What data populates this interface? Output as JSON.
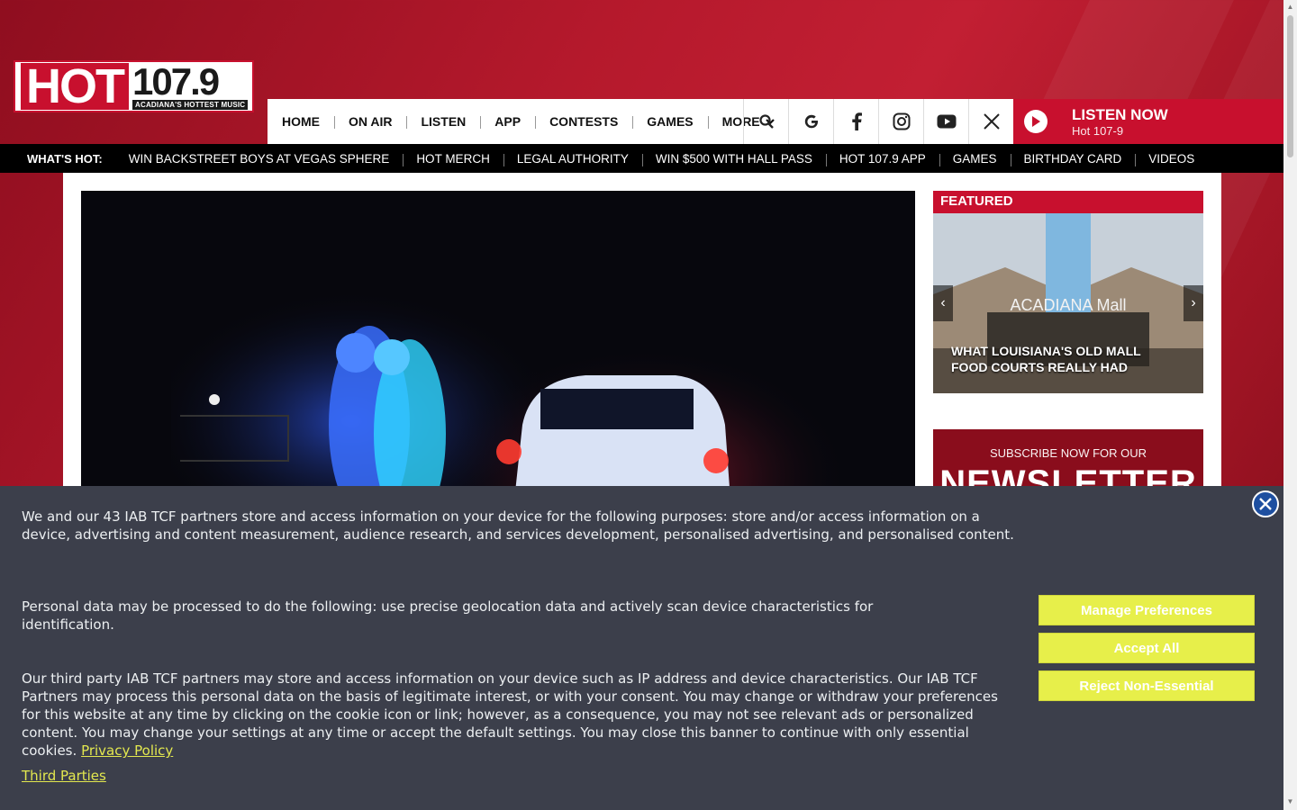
{
  "logo": {
    "main": "HOT",
    "frequency": "107.9",
    "tagline": "ACADIANA'S HOTTEST MUSIC"
  },
  "nav": {
    "items": [
      "HOME",
      "ON AIR",
      "LISTEN",
      "APP",
      "CONTESTS",
      "GAMES"
    ],
    "more": "MORE"
  },
  "listen": {
    "title": "LISTEN NOW",
    "station": "Hot 107-9"
  },
  "hotbar": {
    "label": "WHAT'S HOT:",
    "links": [
      "WIN BACKSTREET BOYS AT VEGAS SPHERE",
      "HOT MERCH",
      "LEGAL AUTHORITY",
      "WIN $500 WITH HALL PASS",
      "HOT 107.9 APP",
      "GAMES",
      "BIRTHDAY CARD",
      "VIDEOS"
    ]
  },
  "featured": {
    "label": "FEATURED",
    "sign_text": "ACADIANA Mall",
    "caption": "WHAT LOUISIANA'S OLD MALL FOOD COURTS REALLY HAD"
  },
  "newsletter": {
    "subtitle": "SUBSCRIBE NOW FOR OUR",
    "title": "NEWSLETTER"
  },
  "cookie": {
    "para1": "We and our 43 IAB TCF partners store and access information on your device for the following purposes: store and/or access information on a device, advertising and content measurement, audience research, and services development, personalised advertising, and personalised content.",
    "para2": "Personal data may be processed to do the following: use precise geolocation data and actively scan device characteristics for identification.",
    "para3": "Our third party IAB TCF partners may store and access information on your device such as IP address and device characteristics. Our IAB TCF Partners may process this personal data on the basis of legitimate interest, or with your consent. You may change or withdraw your preferences for this website at any time by clicking on the cookie icon or link; however, as a consequence, you may not see relevant ads or personalized content. You may change your settings at any time or accept the default settings. You may close this banner to continue with only essential cookies.",
    "privacy_link": "Privacy Policy",
    "third_parties_link": "Third Parties",
    "buttons": {
      "manage": "Manage Preferences",
      "accept": "Accept All",
      "reject": "Reject Non-Essential"
    }
  },
  "colors": {
    "brand_red": "#c8102e",
    "banner_bg": "#3c3f4b",
    "button_yellow": "#e7ef4a",
    "link_yellow": "#e3e84f"
  },
  "icons": [
    "search-icon",
    "google-icon",
    "facebook-icon",
    "instagram-icon",
    "youtube-icon",
    "x-icon",
    "play-icon",
    "close-icon"
  ]
}
